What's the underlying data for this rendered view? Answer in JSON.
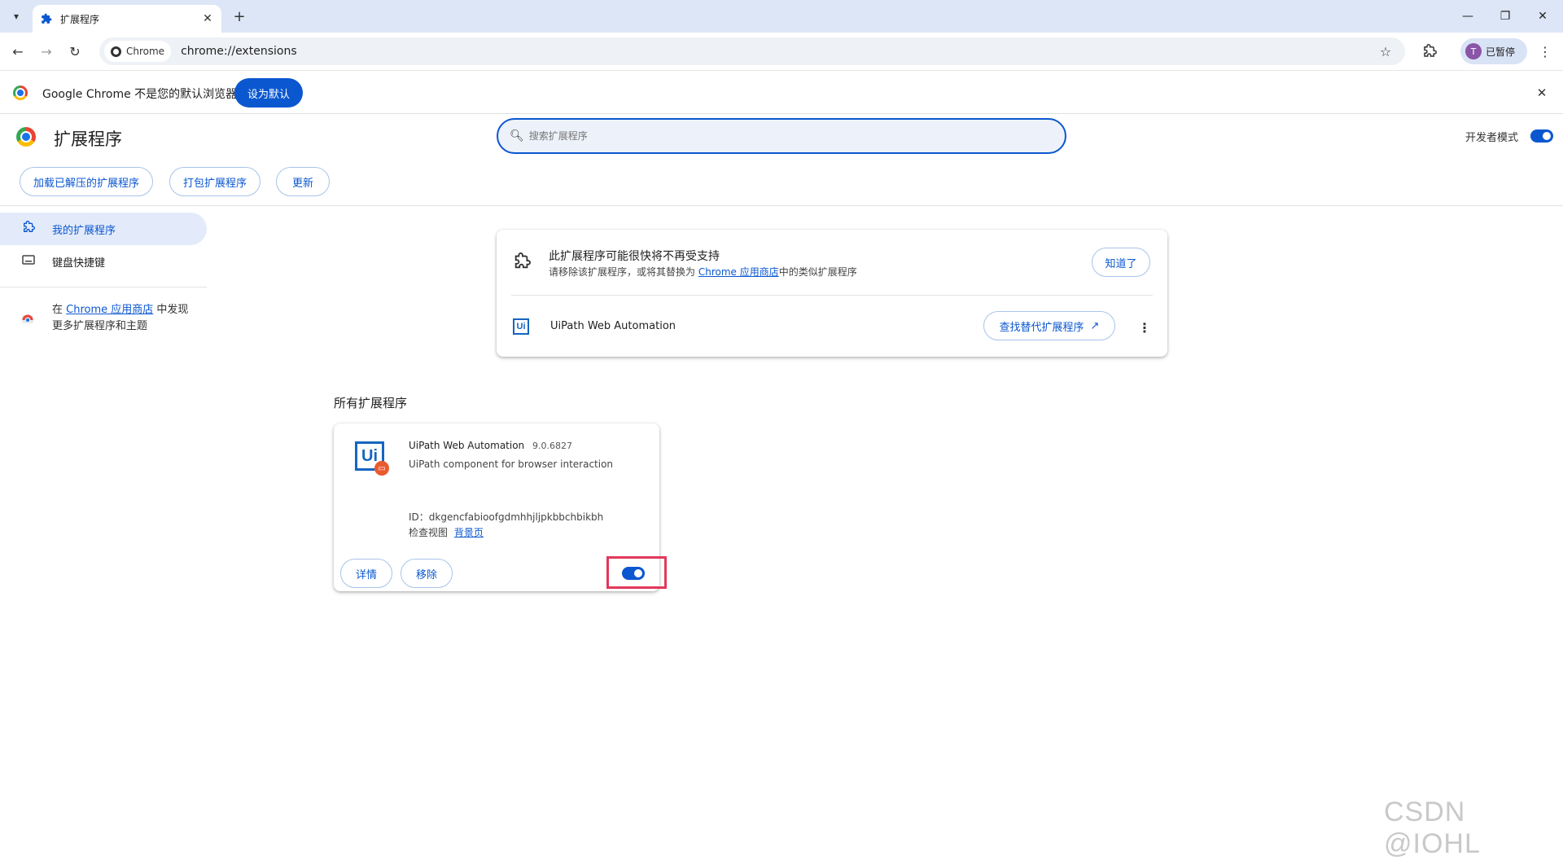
{
  "browser": {
    "tab": {
      "title": "扩展程序"
    },
    "omnibox": {
      "chip": "Chrome",
      "url": "chrome://extensions"
    },
    "profile": {
      "initial": "T",
      "label": "已暂停"
    }
  },
  "infobar": {
    "text": "Google Chrome 不是您的默认浏览器",
    "button": "设为默认"
  },
  "header": {
    "title": "扩展程序",
    "search_placeholder": "搜索扩展程序",
    "dev_mode_label": "开发者模式",
    "dev_mode_on": true,
    "buttons": {
      "load_unpacked": "加载已解压的扩展程序",
      "pack": "打包扩展程序",
      "update": "更新"
    }
  },
  "sidebar": {
    "items": [
      {
        "label": "我的扩展程序",
        "icon": "puzzle-icon",
        "active": true
      },
      {
        "label": "键盘快捷键",
        "icon": "keyboard-icon",
        "active": false
      }
    ],
    "store_prefix": "在 ",
    "store_link": "Chrome 应用商店",
    "store_suffix": " 中发现",
    "store_line2": "更多扩展程序和主题"
  },
  "warning": {
    "title": "此扩展程序可能很快将不再受支持",
    "sub_prefix": "请移除该扩展程序，或将其替换为 ",
    "sub_link": "Chrome 应用商店",
    "sub_suffix": "中的类似扩展程序",
    "got_it": "知道了",
    "ext_name": "UiPath Web Automation",
    "find_alt": "查找替代扩展程序"
  },
  "all_extensions": {
    "title": "所有扩展程序",
    "items": [
      {
        "name": "UiPath Web Automation",
        "version": "9.0.6827",
        "description": "UiPath component for browser interaction",
        "id_label": "ID：",
        "id": "dkgencfabioofgdmhhjljpkbbchbikbh",
        "inspect_label": "检查视图",
        "inspect_link": "背景页",
        "details_btn": "详情",
        "remove_btn": "移除",
        "enabled": true,
        "logo_text": "Ui"
      }
    ]
  },
  "watermark": "CSDN @IOHL",
  "colors": {
    "accent": "#0b57d0",
    "highlight": "#e2385a",
    "tabstrip": "#dde6f6"
  }
}
